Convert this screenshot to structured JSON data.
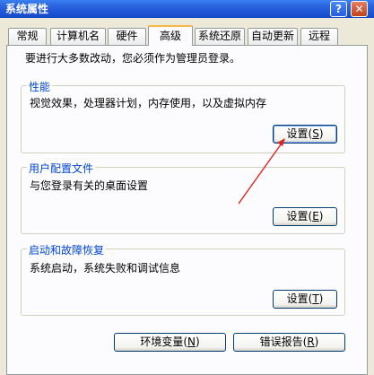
{
  "window": {
    "title": "系统属性"
  },
  "title_buttons": {
    "help": "?",
    "close": "✕"
  },
  "tabs": [
    "常规",
    "计算机名",
    "硬件",
    "高级",
    "系统还原",
    "自动更新",
    "远程"
  ],
  "intro": "要进行大多数改动，您必须作为管理员登录。",
  "groups": {
    "performance": {
      "title": "性能",
      "desc": "视觉效果，处理器计划，内存使用，以及虚拟内存",
      "button": "设置",
      "key": "S"
    },
    "profiles": {
      "title": "用户配置文件",
      "desc": "与您登录有关的桌面设置",
      "button": "设置",
      "key": "E"
    },
    "startup": {
      "title": "启动和故障恢复",
      "desc": "系统启动，系统失败和调试信息",
      "button": "设置",
      "key": "T"
    }
  },
  "bottom": {
    "env_label": "环境变量",
    "env_key": "N",
    "error_label": "错误报告",
    "error_key": "R"
  },
  "colors": {
    "annotation_arrow": "#d9231d",
    "titlebar": "#1d55d6",
    "tab_highlight": "#f8b846"
  }
}
